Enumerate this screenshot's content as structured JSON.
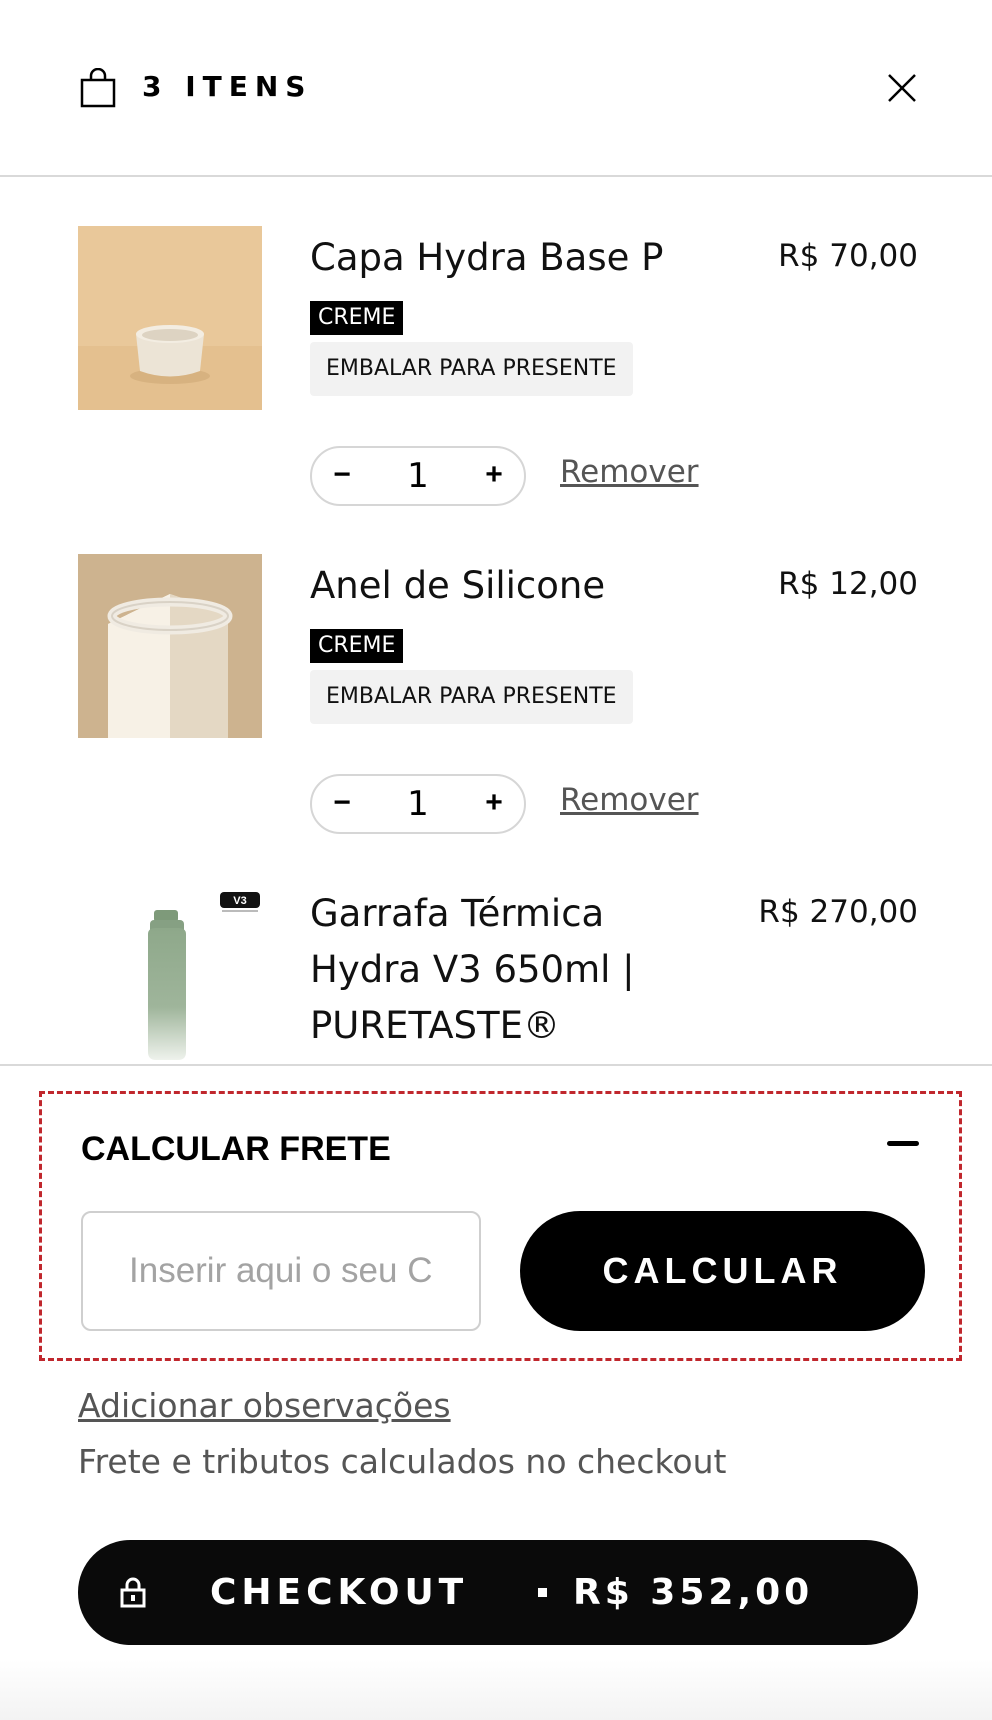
{
  "header": {
    "item_count": "3 ITENS"
  },
  "items": [
    {
      "title": "Capa Hydra Base P",
      "price": "R$ 70,00",
      "variant": "CREME",
      "gift": "EMBALAR PARA PRESENTE",
      "quantity": "1",
      "minus": "−",
      "plus": "+",
      "remove": "Remover"
    },
    {
      "title": "Anel de Silicone",
      "price": "R$ 12,00",
      "variant": "CREME",
      "gift": "EMBALAR PARA PRESENTE",
      "quantity": "1",
      "minus": "−",
      "plus": "+",
      "remove": "Remover"
    },
    {
      "title": "Garrafa Térmica Hydra V3 650ml | PURETASTE®",
      "price": "R$ 270,00",
      "image_label": "V3"
    }
  ],
  "shipping": {
    "title": "CALCULAR FRETE",
    "zip_placeholder": "Inserir aqui o seu CEP",
    "button": "CALCULAR"
  },
  "footer": {
    "notes_link": "Adicionar observações",
    "tax_note": "Frete e tributos calculados no checkout",
    "checkout_label": "CHECKOUT",
    "checkout_total": "R$ 352,00 BRL"
  },
  "colors": {
    "accent": "#000000",
    "dashed_outline": "#c0272d",
    "link": "#555555"
  }
}
